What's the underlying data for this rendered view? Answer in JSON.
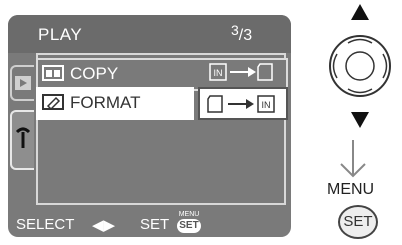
{
  "menu": {
    "title": "PLAY",
    "page_current": "3",
    "page_total": "3",
    "items": [
      {
        "label": "COPY",
        "icon": "copy-icon",
        "value_icon": "internal-to-card-icon",
        "selected": false
      },
      {
        "label": "FORMAT",
        "icon": "format-icon",
        "value_icon": "card-to-internal-icon",
        "selected": true
      }
    ],
    "tabs": [
      {
        "name": "play-tab",
        "icon": "play-icon"
      },
      {
        "name": "setup-tab",
        "icon": "wrench-icon"
      }
    ]
  },
  "bottom_bar": {
    "select_label": "SELECT",
    "select_arrows": "◀▶",
    "set_label": "SET",
    "badge_top": "MENU",
    "badge_bottom": "SET"
  },
  "controls": {
    "menu_label": "MENU",
    "set_button_label": "SET"
  },
  "colors": {
    "screen_bg": "#7a7a7a",
    "title_bg": "#6b6b6b",
    "highlight_bg": "#ffffff",
    "text_light": "#ffffff"
  }
}
